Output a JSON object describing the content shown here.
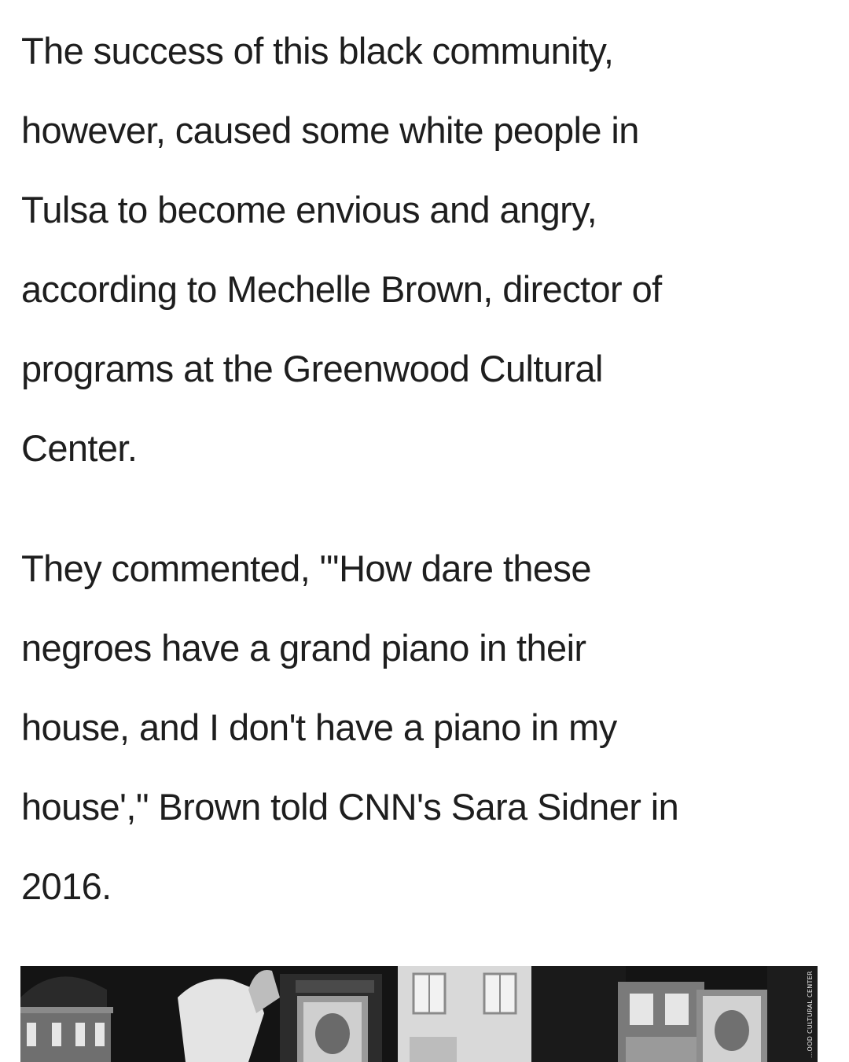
{
  "article": {
    "paragraphs": [
      "The success of this black community,\nhowever, caused some white people in\nTulsa to become envious and angry,\naccording to Mechelle Brown, director of\nprograms at the Greenwood Cultural\nCenter.",
      "They commented, \"'How dare these\nnegroes have a grand piano in their\nhouse, and I don't have a piano in my\nhouse',\" Brown told CNN's Sara Sidner in\n2016."
    ]
  },
  "photo": {
    "credit": "...OOD CULTURAL CENTER"
  }
}
